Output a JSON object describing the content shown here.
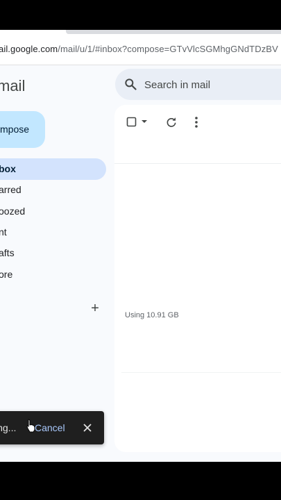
{
  "browser": {
    "url_prefix": "ail.google.com",
    "url_rest": "/mail/u/1/#inbox?compose=GTvVlcSGMhgGNdTDzBV"
  },
  "app": {
    "brand": "mail"
  },
  "compose_label": "mpose",
  "nav": [
    {
      "label": "box",
      "active": true
    },
    {
      "label": "arred",
      "active": false
    },
    {
      "label": "oozed",
      "active": false
    },
    {
      "label": "nt",
      "active": false
    },
    {
      "label": "afts",
      "active": false
    },
    {
      "label": "ore",
      "active": false
    }
  ],
  "labels": {
    "add_icon": "plus-icon"
  },
  "search": {
    "placeholder": "Search in mail"
  },
  "toolbar": {
    "icons": [
      "checkbox-icon",
      "dropdown-arrow-icon",
      "refresh-icon",
      "more-vert-icon"
    ]
  },
  "storage_text": "Using 10.91 GB",
  "toast": {
    "message": "ing...",
    "action": "Cancel",
    "close_icon": "close-icon"
  },
  "colors": {
    "compose_bg": "#c2e7ff",
    "active_nav_bg": "#d3e3fd",
    "search_bg": "#e9eef6",
    "toast_bg": "#1f1f1f",
    "toast_action": "#a8c7fa"
  }
}
